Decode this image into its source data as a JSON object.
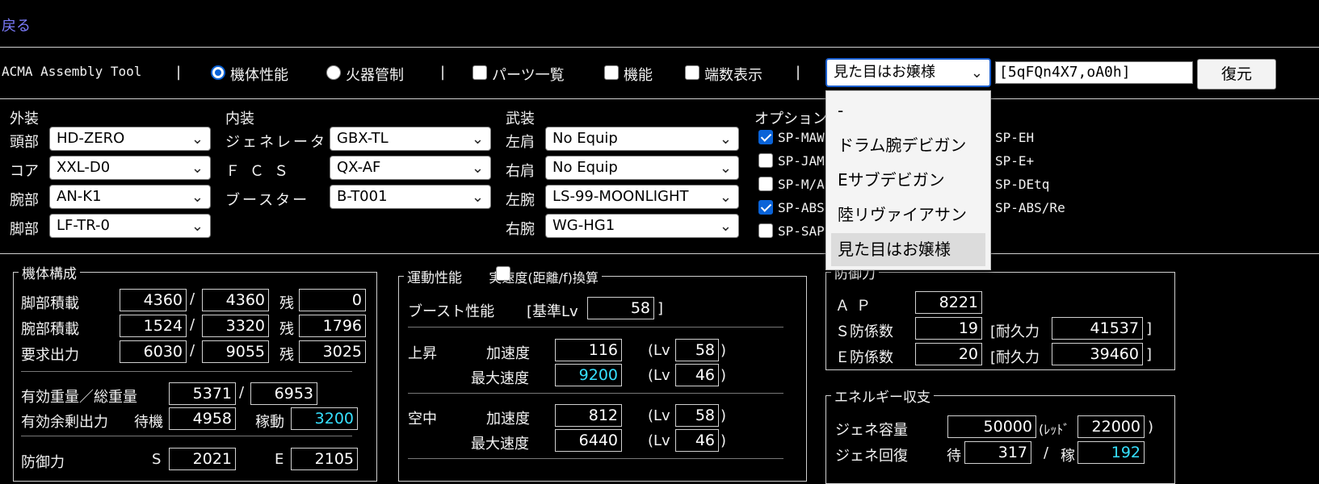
{
  "nav": {
    "back": "戻る"
  },
  "toolbar": {
    "app_title": "ACMA Assembly Tool",
    "sep": "|",
    "radio_frame": "機体性能",
    "radio_fcs": "火器管制",
    "cb_parts": "パーツ一覧",
    "cb_function": "機能",
    "cb_fraction": "端数表示",
    "preset_selected": "見た目はお嬢様",
    "code_value": "[5qFQn4X7,oA0h]",
    "restore_label": "復元"
  },
  "preset_options": [
    "-",
    "ドラム腕デビガン",
    "Eサブデビガン",
    "陸リヴァイアサン",
    "見た目はお嬢様"
  ],
  "outer": {
    "title": "外装",
    "head_label": "頭部",
    "head_value": "HD-ZERO",
    "core_label": "コア",
    "core_value": "XXL-D0",
    "arms_label": "腕部",
    "arms_value": "AN-K1",
    "legs_label": "脚部",
    "legs_value": "LF-TR-0"
  },
  "inner": {
    "title": "内装",
    "gen_label": "ジェネレータ",
    "gen_value": "GBX-TL",
    "fcs_label": "ＦＣＳ",
    "fcs_value": "QX-AF",
    "booster_label": "ブースター",
    "booster_value": "B-T001"
  },
  "weapons": {
    "title": "武装",
    "ls_label": "左肩",
    "ls_value": "No Equip",
    "rs_label": "右肩",
    "rs_value": "No Equip",
    "la_label": "左腕",
    "la_value": "LS-99-MOONLIGHT",
    "ra_label": "右腕",
    "ra_value": "WG-HG1"
  },
  "options": {
    "title": "オプション",
    "col1": [
      {
        "label": "SP-MAW",
        "checked": true
      },
      {
        "label": "SP-JAM",
        "checked": false
      },
      {
        "label": "SP-M/A",
        "checked": false
      },
      {
        "label": "SP-ABS",
        "checked": true
      },
      {
        "label": "SP-SAP",
        "checked": false
      }
    ],
    "col2": [
      "SP-EH",
      "SP-E+",
      "SP-DEtq",
      "SP-ABS/Re"
    ]
  },
  "frame": {
    "title": "機体構成",
    "slash": "/",
    "rem": "残",
    "leg_load_label": "脚部積載",
    "leg_load": "4360",
    "leg_load_max": "4360",
    "leg_load_rem": "0",
    "arm_load_label": "腕部積載",
    "arm_load": "1524",
    "arm_load_max": "3320",
    "arm_load_rem": "1796",
    "power_label": "要求出力",
    "power": "6030",
    "power_max": "9055",
    "power_rem": "3025",
    "weight_label": "有効重量／総重量",
    "weight_eff": "5371",
    "weight_total": "6953",
    "surplus_label": "有効余剰出力",
    "standby_label": "待機",
    "standby": "4958",
    "active_label": "稼動",
    "active": "3200",
    "defense_label": "防御力",
    "def_s_label": "S",
    "def_s": "2021",
    "def_e_label": "E",
    "def_e": "2105"
  },
  "mobility": {
    "title": "運動性能",
    "realspeed_label": "実速度(距離/f)換算",
    "boost_label": "ブースト性能",
    "base_lv_label": "[基準Lv",
    "base_lv": "58",
    "close": "]",
    "rise_label": "上昇",
    "air_label": "空中",
    "accel_label": "加速度",
    "maxspd_label": "最大速度",
    "lv_open": "(Lv",
    "lv_close": ")",
    "rise_accel": "116",
    "rise_accel_lv": "58",
    "rise_max": "9200",
    "rise_max_lv": "46",
    "air_accel": "812",
    "air_accel_lv": "58",
    "air_max": "6440",
    "air_max_lv": "46"
  },
  "defense": {
    "title": "防御力",
    "ap_label": "ＡＰ",
    "ap": "8221",
    "s_label": "Ｓ防係数",
    "s": "19",
    "dur_label": "[耐久力",
    "s_dur": "41537",
    "e_label": "Ｅ防係数",
    "e": "20",
    "e_dur": "39460",
    "close": "]"
  },
  "energy": {
    "title": "エネルギー収支",
    "cap_label": "ジェネ容量",
    "cap": "50000",
    "red_label": "(ﾚｯﾄﾞ",
    "red": "22000",
    "close": ")",
    "regen_label": "ジェネ回復",
    "standby_label": "待",
    "standby": "317",
    "slash": "/",
    "active_label": "稼",
    "active": "192"
  },
  "colors": {
    "accent_cyan": "#36e0ff",
    "link": "#7d7dff",
    "check_blue": "#0a63d8"
  }
}
